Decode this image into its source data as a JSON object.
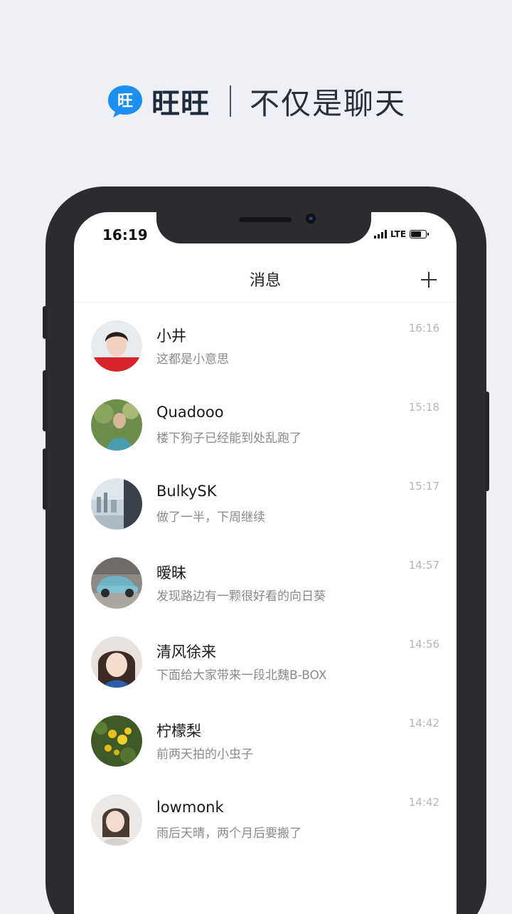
{
  "promo": {
    "brand_name": "旺旺",
    "brand_icon_text": "旺",
    "tagline": "不仅是聊天",
    "colors": {
      "brand_blue": "#1d8ff0",
      "brand_text": "#1f2a3a"
    }
  },
  "status_bar": {
    "time": "16:19",
    "network": "LTE"
  },
  "nav": {
    "title": "消息",
    "add_icon": "plus-icon"
  },
  "conversations": [
    {
      "name": "小井",
      "preview": "这都是小意思",
      "time": "16:16",
      "avatar": "avatar-portrait-red"
    },
    {
      "name": "Quadooo",
      "preview": "楼下狗子已经能到处乱跑了",
      "time": "15:18",
      "avatar": "avatar-outdoor-green"
    },
    {
      "name": "BulkySK",
      "preview": "做了一半，下周继续",
      "time": "15:17",
      "avatar": "avatar-window-view"
    },
    {
      "name": "暧昧",
      "preview": "发现路边有一颗很好看的向日葵",
      "time": "14:57",
      "avatar": "avatar-blue-car"
    },
    {
      "name": "清风徐来",
      "preview": "下面给大家带来一段北魏B-BOX",
      "time": "14:56",
      "avatar": "avatar-girl-blue"
    },
    {
      "name": "柠檬梨",
      "preview": "前两天拍的小虫子",
      "time": "14:42",
      "avatar": "avatar-yellow-flowers"
    },
    {
      "name": "lowmonk",
      "preview": "雨后天晴，两个月后要搬了",
      "time": "14:42",
      "avatar": "avatar-portrait-light"
    }
  ]
}
